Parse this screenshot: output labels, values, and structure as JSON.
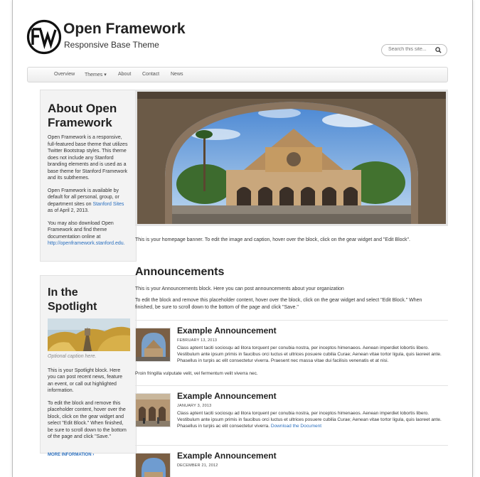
{
  "header": {
    "site_name": "Open Framework",
    "site_slogan": "Responsive Base Theme",
    "logo_icon": "open-framework-logo-icon",
    "search_placeholder": "Search this site..."
  },
  "nav": {
    "items": [
      "Overview",
      "Themes ▾",
      "About",
      "Contact",
      "News"
    ]
  },
  "sidebar": {
    "about": {
      "title": "About Open Framework",
      "p1": "Open Framework is a responsive, full-featured base theme that utilizes Twitter Bootstrap styles. This theme does not include any Stanford branding elements and is used as a base theme for Stanford Framework and its subthemes.",
      "p2_before": "Open Framework is available by default for all personal, group, or department sites on ",
      "p2_link": "Stanford Sites",
      "p2_after": " as of April 2, 2013.",
      "p3": "You may also download Open Framework and find theme documentation online at",
      "p3_link": "http://openframework.stanford.edu."
    },
    "spotlight": {
      "title": "In the Spotlight",
      "caption": "Optional caption here.",
      "p1": "This is your Spotlight block. Here you can post recent news, feature an event, or call out highlighted information.",
      "p2": "To edit the block and remove this placeholder content, hover over the block, click on the gear widget and select \"Edit Block.\" When finished, be sure to scroll down to the bottom of the page and click \"Save.\"",
      "more_link": "MORE INFORMATION ›"
    }
  },
  "main": {
    "banner_caption": "This is your homepage banner. To edit the image and caption, hover over the block, click on the gear widget and \"Edit Block\".",
    "announcements": {
      "title": "Announcements",
      "intro1": "This is your Announcements block. Here you can post announcements about your organization",
      "intro2": "To edit the block and remove this placeholder content, hover over the block, click on the gear widget and select \"Edit Block.\" When finished, be sure to scroll down to the bottom of the page and click \"Save.\"",
      "items": [
        {
          "title": "Example Announcement",
          "date": "FEBRUARY 13, 2013",
          "body": "Class aptent taciti sociosqu ad litora torquent per conubia nostra, per inceptos himenaeos. Aenean imperdiet lobortis libero. Vestibulum ante ipsum primis in faucibus orci luctus et ultrices posuere cubilia Curae; Aenean vitae tortor ligula, quis laoreet ante. Phasellus in turpis ac elit consectetur viverra. Praesent nec massa vitae dui facilisis venenatis et at nisi.",
          "body_cont": "Proin fringilla vulputate velit, vel fermentum velit viverra nec."
        },
        {
          "title": "Example Announcement",
          "date": "JANUARY 3, 2013",
          "body": "Class aptent taciti sociosqu ad litora torquent per conubia nostra, per inceptos himenaeos. Aenean imperdiet lobortis libero. Vestibulum ante ipsum primis in faucibus orci luctus et ultrices posuere cubilia Curae; Aenean vitae tortor ligula, quis laoreet ante. Phasellus in turpis ac elit consectetur viverra.",
          "link": "Download the Document"
        },
        {
          "title": "Example Announcement",
          "date": "DECEMBER 21, 2012"
        }
      ]
    }
  },
  "colors": {
    "link": "#2a6fbf",
    "sidebar_bg": "#f3f3f3",
    "heading": "#222222"
  }
}
